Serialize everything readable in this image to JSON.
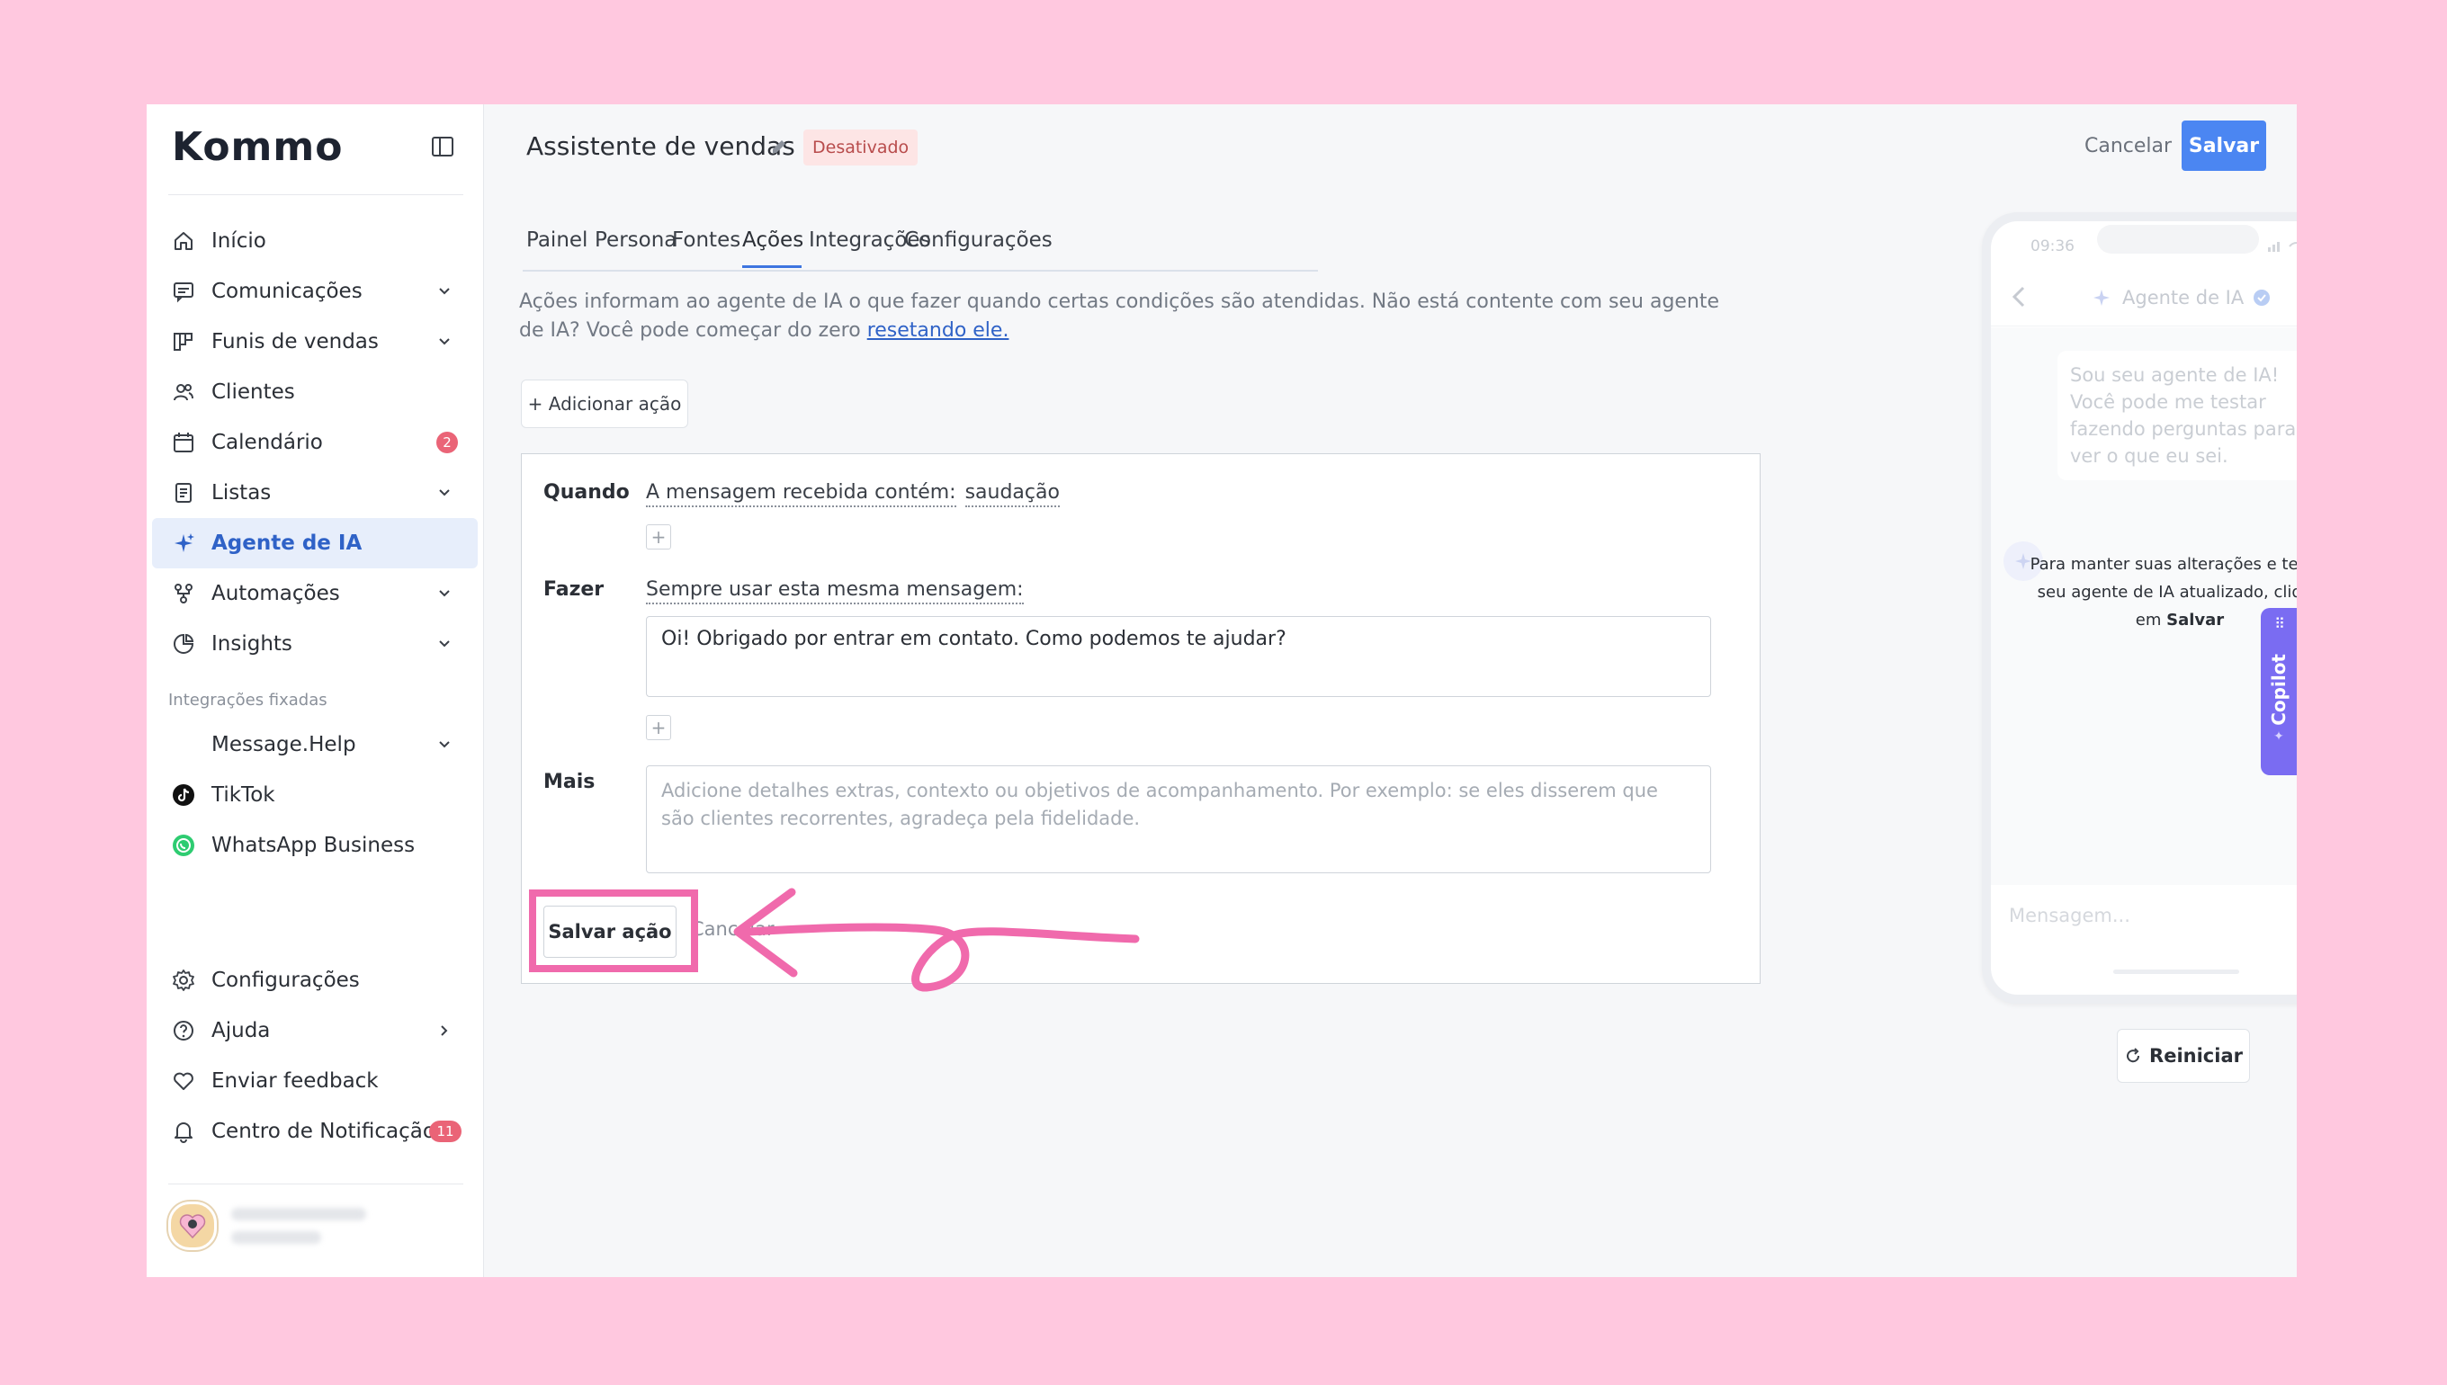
{
  "brand": {
    "logo_text": "Kommo"
  },
  "sidebar": {
    "items": [
      {
        "label": "Início",
        "icon": "home-icon"
      },
      {
        "label": "Comunicações",
        "icon": "chat-icon"
      },
      {
        "label": "Funis de vendas",
        "icon": "funnel-board-icon"
      },
      {
        "label": "Clientes",
        "icon": "users-icon"
      },
      {
        "label": "Calendário",
        "icon": "calendar-icon",
        "badge": "2"
      },
      {
        "label": "Listas",
        "icon": "list-icon"
      },
      {
        "label": "Agente de IA",
        "icon": "sparkle-icon",
        "active": true
      },
      {
        "label": "Automações",
        "icon": "automation-icon"
      },
      {
        "label": "Insights",
        "icon": "insights-icon"
      }
    ],
    "pinned_section_label": "Integrações fixadas",
    "pinned": [
      {
        "label": "Message.Help"
      },
      {
        "label": "TikTok",
        "icon": "tiktok-icon"
      },
      {
        "label": "WhatsApp Business",
        "icon": "whatsapp-icon"
      }
    ],
    "bottom": [
      {
        "label": "Configurações",
        "icon": "gear-icon"
      },
      {
        "label": "Ajuda",
        "icon": "help-icon"
      },
      {
        "label": "Enviar feedback",
        "icon": "heart-icon"
      },
      {
        "label": "Centro de Notificação",
        "icon": "bell-icon",
        "badge": "11"
      }
    ]
  },
  "header": {
    "title": "Assistente de vendas",
    "status": "Desativado",
    "cancel_label": "Cancelar",
    "save_label": "Salvar"
  },
  "tabs": [
    {
      "label": "Painel"
    },
    {
      "label": "Persona"
    },
    {
      "label": "Fontes"
    },
    {
      "label": "Ações",
      "active": true
    },
    {
      "label": "Integrações"
    },
    {
      "label": "Configurações"
    }
  ],
  "intro": {
    "text": "Ações informam ao agente de IA o que fazer quando certas condições são atendidas. Não está contente com seu agente de IA? Você pode começar do zero ",
    "link": "resetando ele."
  },
  "add_action_label": "+ Adicionar ação",
  "action_card": {
    "when_label": "Quando",
    "condition": "A mensagem recebida contém:",
    "condition_value": "saudação",
    "do_label": "Fazer",
    "do_text": "Sempre usar esta mesma mensagem:",
    "message": "Oi! Obrigado por entrar em contato. Como podemos te ajudar?",
    "more_label": "Mais",
    "more_placeholder": "Adicione detalhes extras, contexto ou objetivos de acompanhamento. Por exemplo: se eles disserem que são clientes recorrentes, agradeça pela fidelidade.",
    "plus": "+",
    "save_label": "Salvar ação",
    "cancel_label": "Cancelar"
  },
  "phone": {
    "time": "09:36",
    "agent_title": "Agente de IA",
    "bot_message": "Sou seu agente de IA! Você pode me testar fazendo perguntas para ver o que eu sei.",
    "note_text": "Para manter suas alterações e testar seu agente de IA atualizado, clique em ",
    "note_bold": "Salvar",
    "input_placeholder": "Mensagem..."
  },
  "restart_label": "Reiniciar",
  "copilot_label": "Copilot",
  "colors": {
    "accent": "#4b86f2",
    "active_bg": "#e7eefb",
    "badge": "#ea6477",
    "annotation": "#f06aac",
    "page_bg": "#ffc8df"
  }
}
